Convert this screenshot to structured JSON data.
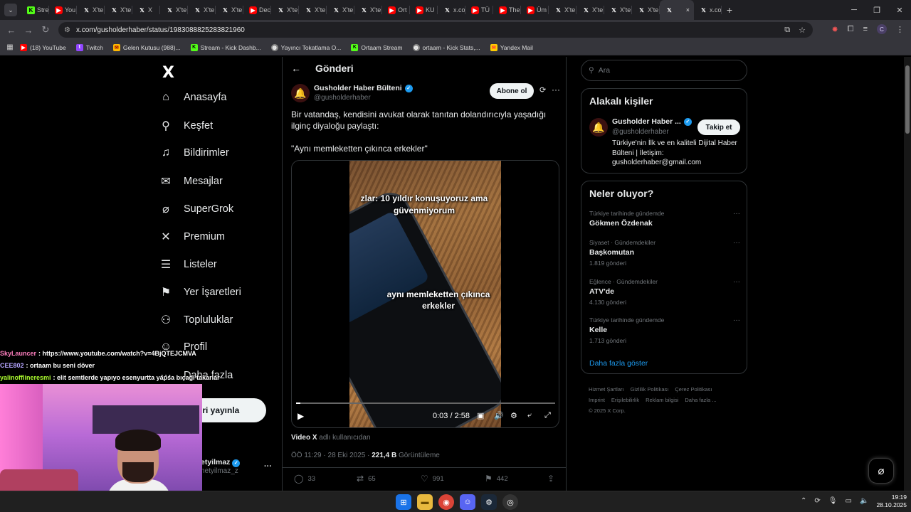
{
  "browser": {
    "tabs": [
      {
        "label": "Stre",
        "favicon": "kick-icon"
      },
      {
        "label": "You",
        "favicon": "youtube-icon"
      },
      {
        "label": "X'te",
        "favicon": "x-icon"
      },
      {
        "label": "X'te",
        "favicon": "x-icon"
      },
      {
        "label": "X",
        "favicon": "x-icon"
      },
      {
        "label": "X'te",
        "favicon": "x-icon"
      },
      {
        "label": "X'te",
        "favicon": "x-icon"
      },
      {
        "label": "X'te",
        "favicon": "x-icon"
      },
      {
        "label": "Dec",
        "favicon": "youtube-icon"
      },
      {
        "label": "X'te",
        "favicon": "x-icon"
      },
      {
        "label": "X'te",
        "favicon": "x-icon"
      },
      {
        "label": "X'te",
        "favicon": "x-icon"
      },
      {
        "label": "X'te",
        "favicon": "x-icon"
      },
      {
        "label": "Ort",
        "favicon": "youtube-icon"
      },
      {
        "label": "KU",
        "favicon": "youtube-icon"
      },
      {
        "label": "x.co",
        "favicon": "x-icon"
      },
      {
        "label": "TÜ",
        "favicon": "youtube-icon"
      },
      {
        "label": "The",
        "favicon": "youtube-icon"
      },
      {
        "label": "Üm",
        "favicon": "youtube-icon"
      },
      {
        "label": "X'te",
        "favicon": "x-icon"
      },
      {
        "label": "X'te",
        "favicon": "x-icon"
      },
      {
        "label": "X'te",
        "favicon": "x-icon"
      },
      {
        "label": "X'te",
        "favicon": "x-icon"
      }
    ],
    "active_tab_close": "×",
    "last_tab": {
      "label": "x.co",
      "favicon": "x-icon"
    },
    "new_tab": "+",
    "url": "x.com/gusholderhaber/status/1983088825283821960",
    "bookmarks": [
      {
        "label": "(18) YouTube",
        "icon": "youtube-icon"
      },
      {
        "label": "Twitch",
        "icon": "twitch-icon"
      },
      {
        "label": "Gelen Kutusu (988)...",
        "icon": "mail-icon"
      },
      {
        "label": "Stream - Kick Dashb...",
        "icon": "kick-icon"
      },
      {
        "label": "Yayıncı Tokatlama O...",
        "icon": "globe-icon"
      },
      {
        "label": "Ortaam Stream",
        "icon": "kick-icon"
      },
      {
        "label": "ortaam - Kick Stats,...",
        "icon": "globe-icon"
      },
      {
        "label": "Yandex Mail",
        "icon": "mail-icon"
      }
    ],
    "profile_initial": "C"
  },
  "sidebar": {
    "logo": "X",
    "items": [
      {
        "label": "Anasayfa",
        "icon": "home-icon"
      },
      {
        "label": "Keşfet",
        "icon": "search-icon"
      },
      {
        "label": "Bildirimler",
        "icon": "bell-icon"
      },
      {
        "label": "Mesajlar",
        "icon": "mail-icon"
      },
      {
        "label": "SuperGrok",
        "icon": "grok-icon"
      },
      {
        "label": "Premium",
        "icon": "x-icon"
      },
      {
        "label": "Listeler",
        "icon": "list-icon"
      },
      {
        "label": "Yer İşaretleri",
        "icon": "bookmark-icon"
      },
      {
        "label": "Topluluklar",
        "icon": "communities-icon"
      },
      {
        "label": "Profil",
        "icon": "person-icon"
      },
      {
        "label": "Daha fazla",
        "icon": "more-icon"
      }
    ],
    "post_button": "eri yayınla",
    "account": {
      "name": "etyilmaz",
      "handle": "netyilmaz_z"
    }
  },
  "main": {
    "header": "Gönderi",
    "author": {
      "name": "Gusholder Haber Bülteni",
      "handle": "@gusholderhaber"
    },
    "subscribe": "Abone ol",
    "text": "Bir vatandaş, kendisini avukat olarak tanıtan dolandırıcıyla yaşadığı ilginç diyaloğu paylaştı:",
    "quote": "\"Aynı memleketten çıkınca erkekler\"",
    "video": {
      "caption_top": "zlar: 10 yıldır konuşuyoruz ama güvenmiyorum",
      "caption_bottom": "aynı memleketten çıkınca erkekler",
      "time": "0:03 / 2:58",
      "progress": 0.017
    },
    "video_source": {
      "prefix": "Video X",
      "suffix": "adlı kullanıcıdan"
    },
    "timestamp": "ÖÖ 11:29 · 28 Eki 2025 ·",
    "views_count": "221,4 B",
    "views_label": "Görüntüleme",
    "stats": {
      "replies": "33",
      "reposts": "65",
      "likes": "991",
      "bookmarks": "442"
    }
  },
  "right": {
    "search_placeholder": "Ara",
    "related": {
      "title": "Alakalı kişiler",
      "name": "Gusholder Haber ...",
      "handle": "@gusholderhaber",
      "follow": "Takip et",
      "bio": "Türkiye'nin İlk ve en kaliteli Dijital Haber Bülteni | İletişim: gusholderhaber@gmail.com"
    },
    "trends": {
      "title": "Neler oluyor?",
      "items": [
        {
          "category": "Türkiye tarihinde gündemde",
          "name": "Gökmen Özdenak",
          "count": ""
        },
        {
          "category": "Siyaset · Gündemdekiler",
          "name": "Başkomutan",
          "count": "1.819 gönderi"
        },
        {
          "category": "Eğlence · Gündemdekiler",
          "name": "ATV'de",
          "count": "4.130 gönderi"
        },
        {
          "category": "Türkiye tarihinde gündemde",
          "name": "Kelle",
          "count": "1.713 gönderi"
        }
      ],
      "show_more": "Daha fazla göster"
    },
    "footer": {
      "links": [
        "Hizmet Şartları",
        "Gizlilik Politikası",
        "Çerez Politikası",
        "Imprint",
        "Erişilebilirlik",
        "Reklam bilgisi",
        "Daha fazla ..."
      ],
      "copyright": "© 2025 X Corp."
    }
  },
  "chat": [
    {
      "user": "SkyLauncer",
      "color": "#ff7fbf",
      "text": ": https://www.youtube.com/watch?v=4BjQTEJCMVA"
    },
    {
      "user": "CEE802",
      "color": "#b4a5ff",
      "text": ": ortaam bu seni döver"
    },
    {
      "user": "yalinofflineresmi",
      "color": "#adff2f",
      "text": ": elit semtlerde yapıyo esenyurtta yapsa bıçağı takarlar"
    }
  ],
  "taskbar": {
    "time": "19:19",
    "date": "28.10.2025"
  },
  "colors": {
    "accent": "#1d9bf0",
    "background": "#000000",
    "text": "#e7e9ea",
    "muted": "#71767b"
  }
}
